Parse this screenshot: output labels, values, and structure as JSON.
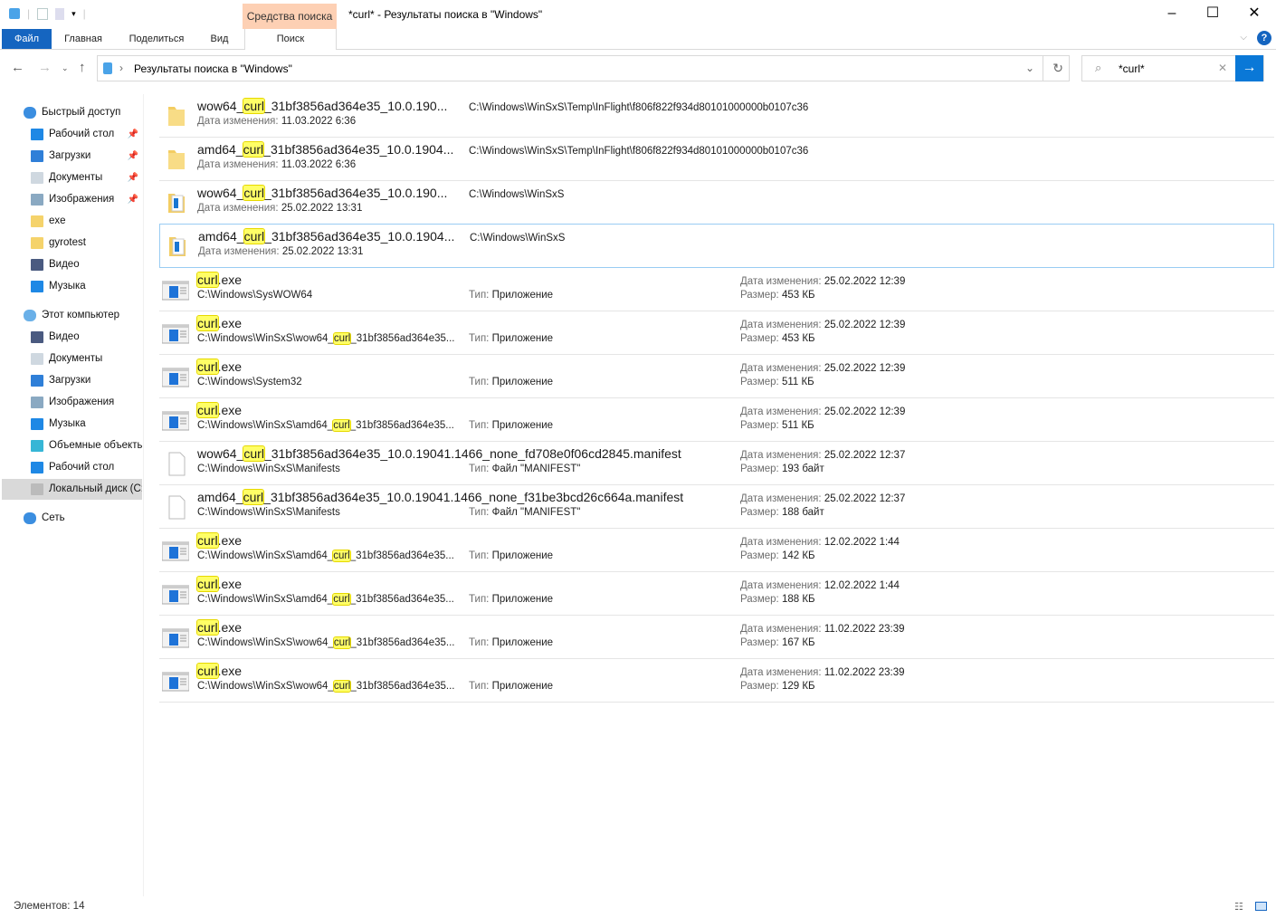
{
  "window": {
    "title": "*curl* - Результаты поиска в \"Windows\"",
    "context_tab": "Средства поиска"
  },
  "ribbon": {
    "tabs": [
      "Файл",
      "Главная",
      "Поделиться",
      "Вид",
      "Поиск"
    ]
  },
  "address": {
    "path": "Результаты поиска в \"Windows\""
  },
  "search": {
    "value": "*curl*"
  },
  "sidebar": {
    "items": [
      {
        "label": "Быстрый доступ",
        "icon": "star-icon",
        "level": 0,
        "pin": false
      },
      {
        "label": "Рабочий стол",
        "icon": "desktop-icon",
        "level": 1,
        "pin": true
      },
      {
        "label": "Загрузки",
        "icon": "download-icon",
        "level": 1,
        "pin": true
      },
      {
        "label": "Документы",
        "icon": "documents-icon",
        "level": 1,
        "pin": true
      },
      {
        "label": "Изображения",
        "icon": "pictures-icon",
        "level": 1,
        "pin": true
      },
      {
        "label": "exe",
        "icon": "folder-icon",
        "level": 1,
        "pin": false
      },
      {
        "label": "gyrotest",
        "icon": "folder-icon",
        "level": 1,
        "pin": false
      },
      {
        "label": "Видео",
        "icon": "video-icon",
        "level": 1,
        "pin": false
      },
      {
        "label": "Музыка",
        "icon": "music-icon",
        "level": 1,
        "pin": false
      },
      {
        "label": "Этот компьютер",
        "icon": "computer-icon",
        "level": 0,
        "pin": false,
        "gap": true
      },
      {
        "label": "Видео",
        "icon": "video-icon",
        "level": 1,
        "pin": false
      },
      {
        "label": "Документы",
        "icon": "documents-icon",
        "level": 1,
        "pin": false
      },
      {
        "label": "Загрузки",
        "icon": "download-icon",
        "level": 1,
        "pin": false
      },
      {
        "label": "Изображения",
        "icon": "pictures-icon",
        "level": 1,
        "pin": false
      },
      {
        "label": "Музыка",
        "icon": "music-icon",
        "level": 1,
        "pin": false
      },
      {
        "label": "Объемные объекты",
        "icon": "3d-objects-icon",
        "level": 1,
        "pin": false
      },
      {
        "label": "Рабочий стол",
        "icon": "desktop-icon",
        "level": 1,
        "pin": false
      },
      {
        "label": "Локальный диск (C:)",
        "icon": "drive-icon",
        "level": 1,
        "pin": false,
        "selected": true
      },
      {
        "label": "Сеть",
        "icon": "network-icon",
        "level": 0,
        "pin": false,
        "gap": true
      }
    ]
  },
  "results": [
    {
      "icon": "folder",
      "name": [
        "wow64_",
        "curl",
        "_31bf3856ad364e35_10.0.190..."
      ],
      "sub": [
        "Дата изменения:",
        "11.03.2022 6:36"
      ],
      "mid1": "C:\\Windows\\WinSxS\\Temp\\InFlight\\f806f822f934d80101000000b0107c36"
    },
    {
      "icon": "folder",
      "name": [
        "amd64_",
        "curl",
        "_31bf3856ad364e35_10.0.1904..."
      ],
      "sub": [
        "Дата изменения:",
        "11.03.2022 6:36"
      ],
      "mid1": "C:\\Windows\\WinSxS\\Temp\\InFlight\\f806f822f934d80101000000b0107c36"
    },
    {
      "icon": "folder-doc",
      "name": [
        "wow64_",
        "curl",
        "_31bf3856ad364e35_10.0.190..."
      ],
      "sub": [
        "Дата изменения:",
        "25.02.2022 13:31"
      ],
      "mid1": "C:\\Windows\\WinSxS"
    },
    {
      "icon": "folder-doc",
      "selected": true,
      "name": [
        "amd64_",
        "curl",
        "_31bf3856ad364e35_10.0.1904..."
      ],
      "sub": [
        "Дата изменения:",
        "25.02.2022 13:31"
      ],
      "mid1": "C:\\Windows\\WinSxS"
    },
    {
      "icon": "exe",
      "name": [
        "",
        "curl",
        ".exe"
      ],
      "path": [
        "C:\\Windows\\SysWOW64",
        "",
        ""
      ],
      "type": [
        "Тип:",
        "Приложение"
      ],
      "date": [
        "Дата изменения:",
        "25.02.2022 12:39"
      ],
      "size": [
        "Размер:",
        "453 КБ"
      ]
    },
    {
      "icon": "exe",
      "name": [
        "",
        "curl",
        ".exe"
      ],
      "path": [
        "C:\\Windows\\WinSxS\\wow64_",
        "curl",
        "_31bf3856ad364e35..."
      ],
      "type": [
        "Тип:",
        "Приложение"
      ],
      "date": [
        "Дата изменения:",
        "25.02.2022 12:39"
      ],
      "size": [
        "Размер:",
        "453 КБ"
      ]
    },
    {
      "icon": "exe",
      "name": [
        "",
        "curl",
        ".exe"
      ],
      "path": [
        "C:\\Windows\\System32",
        "",
        ""
      ],
      "type": [
        "Тип:",
        "Приложение"
      ],
      "date": [
        "Дата изменения:",
        "25.02.2022 12:39"
      ],
      "size": [
        "Размер:",
        "511 КБ"
      ]
    },
    {
      "icon": "exe",
      "name": [
        "",
        "curl",
        ".exe"
      ],
      "path": [
        "C:\\Windows\\WinSxS\\amd64_",
        "curl",
        "_31bf3856ad364e35..."
      ],
      "type": [
        "Тип:",
        "Приложение"
      ],
      "date": [
        "Дата изменения:",
        "25.02.2022 12:39"
      ],
      "size": [
        "Размер:",
        "511 КБ"
      ]
    },
    {
      "icon": "file",
      "name": [
        "wow64_",
        "curl",
        "_31bf3856ad364e35_10.0.19041.1466_none_fd708e0f06cd2845.manifest"
      ],
      "path": [
        "C:\\Windows\\WinSxS\\Manifests",
        "",
        ""
      ],
      "type": [
        "Тип:",
        "Файл \"MANIFEST\""
      ],
      "date": [
        "Дата изменения:",
        "25.02.2022 12:37"
      ],
      "size": [
        "Размер:",
        "193 байт"
      ]
    },
    {
      "icon": "file",
      "name": [
        "amd64_",
        "curl",
        "_31bf3856ad364e35_10.0.19041.1466_none_f31be3bcd26c664a.manifest"
      ],
      "path": [
        "C:\\Windows\\WinSxS\\Manifests",
        "",
        ""
      ],
      "type": [
        "Тип:",
        "Файл \"MANIFEST\""
      ],
      "date": [
        "Дата изменения:",
        "25.02.2022 12:37"
      ],
      "size": [
        "Размер:",
        "188 байт"
      ]
    },
    {
      "icon": "exe",
      "name": [
        "",
        "curl",
        ".exe"
      ],
      "path": [
        "C:\\Windows\\WinSxS\\amd64_",
        "curl",
        "_31bf3856ad364e35..."
      ],
      "type": [
        "Тип:",
        "Приложение"
      ],
      "date": [
        "Дата изменения:",
        "12.02.2022 1:44"
      ],
      "size": [
        "Размер:",
        "142 КБ"
      ]
    },
    {
      "icon": "exe",
      "name": [
        "",
        "curl",
        ".exe"
      ],
      "path": [
        "C:\\Windows\\WinSxS\\amd64_",
        "curl",
        "_31bf3856ad364e35..."
      ],
      "type": [
        "Тип:",
        "Приложение"
      ],
      "date": [
        "Дата изменения:",
        "12.02.2022 1:44"
      ],
      "size": [
        "Размер:",
        "188 КБ"
      ]
    },
    {
      "icon": "exe",
      "name": [
        "",
        "curl",
        ".exe"
      ],
      "path": [
        "C:\\Windows\\WinSxS\\wow64_",
        "curl",
        "_31bf3856ad364e35..."
      ],
      "type": [
        "Тип:",
        "Приложение"
      ],
      "date": [
        "Дата изменения:",
        "11.02.2022 23:39"
      ],
      "size": [
        "Размер:",
        "167 КБ"
      ]
    },
    {
      "icon": "exe",
      "name": [
        "",
        "curl",
        ".exe"
      ],
      "path": [
        "C:\\Windows\\WinSxS\\wow64_",
        "curl",
        "_31bf3856ad364e35..."
      ],
      "type": [
        "Тип:",
        "Приложение"
      ],
      "date": [
        "Дата изменения:",
        "11.02.2022 23:39"
      ],
      "size": [
        "Размер:",
        "129 КБ"
      ]
    }
  ],
  "status": {
    "count": "Элементов: 14"
  }
}
